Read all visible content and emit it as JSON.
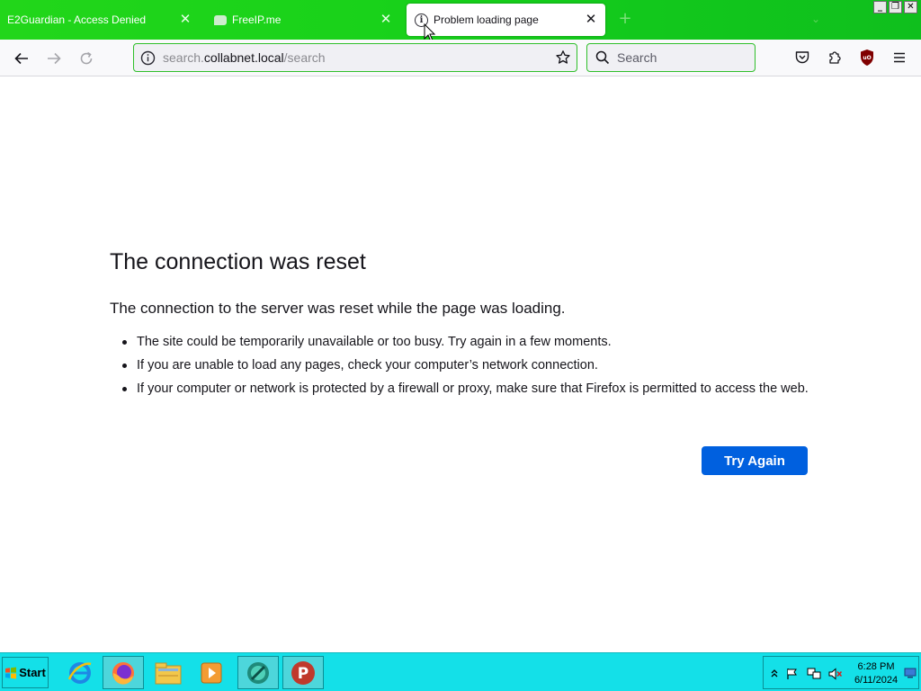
{
  "tabs": [
    {
      "title": "E2Guardian - Access Denied"
    },
    {
      "title": "FreeIP.me"
    },
    {
      "title": "Problem loading page"
    }
  ],
  "toolbar": {
    "url_prefix": "search.",
    "url_domain": "collabnet.local",
    "url_path": "/search",
    "search_placeholder": "Search"
  },
  "error": {
    "title": "The connection was reset",
    "description": "The connection to the server was reset while the page was loading.",
    "items": [
      "The site could be temporarily unavailable or too busy. Try again in a few moments.",
      "If you are unable to load any pages, check your computer’s network connection.",
      "If your computer or network is protected by a firewall or proxy, make sure that Firefox is permitted to access the web."
    ],
    "button_label": "Try Again"
  },
  "taskbar": {
    "start_label": "Start",
    "time": "6:28 PM",
    "date": "6/11/2024"
  },
  "colors": {
    "tabstrip": "#1ad21a",
    "accent_button": "#0060df",
    "taskbar": "#14e0e8"
  }
}
